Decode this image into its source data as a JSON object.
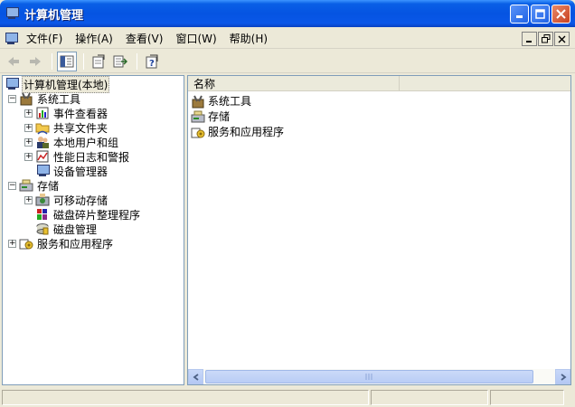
{
  "window": {
    "title": "计算机管理"
  },
  "menu": {
    "items": [
      {
        "label": "文件(F)"
      },
      {
        "label": "操作(A)"
      },
      {
        "label": "查看(V)"
      },
      {
        "label": "窗口(W)"
      },
      {
        "label": "帮助(H)"
      }
    ]
  },
  "tree": {
    "root": "计算机管理(本地)",
    "system_tools": "系统工具",
    "event_viewer": "事件查看器",
    "shared_folders": "共享文件夹",
    "local_users": "本地用户和组",
    "perf_logs": "性能日志和警报",
    "device_manager": "设备管理器",
    "storage": "存储",
    "removable_storage": "可移动存储",
    "disk_defrag": "磁盘碎片整理程序",
    "disk_management": "磁盘管理",
    "services_apps": "服务和应用程序"
  },
  "list": {
    "column_name": "名称",
    "rows": [
      {
        "label": "系统工具"
      },
      {
        "label": "存储"
      },
      {
        "label": "服务和应用程序"
      }
    ]
  },
  "icons": {
    "app": "computer-management-icon",
    "back": "back-arrow-icon",
    "forward": "forward-arrow-icon"
  }
}
